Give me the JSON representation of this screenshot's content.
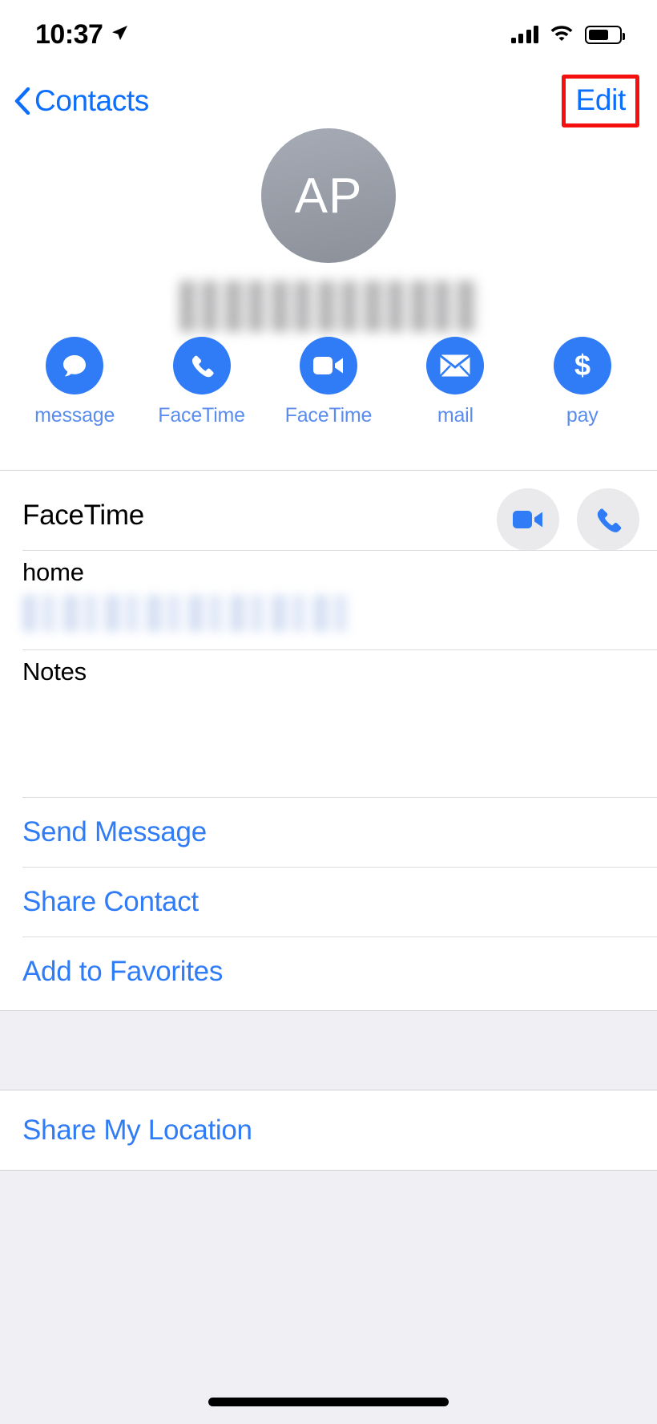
{
  "status_bar": {
    "time": "10:37",
    "location_icon": "location-arrow-icon",
    "cellular_icon": "signal-bars-icon",
    "wifi_icon": "wifi-icon",
    "battery_icon": "battery-icon",
    "battery_level_percent": 62
  },
  "nav": {
    "back_label": "Contacts",
    "back_icon": "chevron-left-icon",
    "edit_label": "Edit",
    "edit_highlight_color": "#f50f0f"
  },
  "contact": {
    "avatar_initials": "AP",
    "avatar_color": "#8b9099",
    "name_redacted": true,
    "name": ""
  },
  "quick_actions": [
    {
      "label": "message",
      "icon": "message-bubble-icon"
    },
    {
      "label": "FaceTime",
      "icon": "phone-icon"
    },
    {
      "label": "FaceTime",
      "icon": "video-camera-icon"
    },
    {
      "label": "mail",
      "icon": "envelope-icon"
    },
    {
      "label": "pay",
      "icon": "dollar-sign-icon"
    }
  ],
  "facetime_row": {
    "label": "FaceTime",
    "video_button_icon": "video-camera-icon",
    "audio_button_icon": "phone-icon"
  },
  "phone_field": {
    "label": "home",
    "value_redacted": true,
    "value": ""
  },
  "notes_field": {
    "label": "Notes",
    "value": ""
  },
  "actions": [
    {
      "label": "Send Message"
    },
    {
      "label": "Share Contact"
    },
    {
      "label": "Add to Favorites"
    }
  ],
  "location_action": {
    "label": "Share My Location"
  },
  "theme": {
    "accent_blue": "#2f7cf6",
    "link_blue": "#0b6efd",
    "label_blue": "#5b8def",
    "separator": "#d2d2d6",
    "band_bg": "#f0f0f4"
  }
}
